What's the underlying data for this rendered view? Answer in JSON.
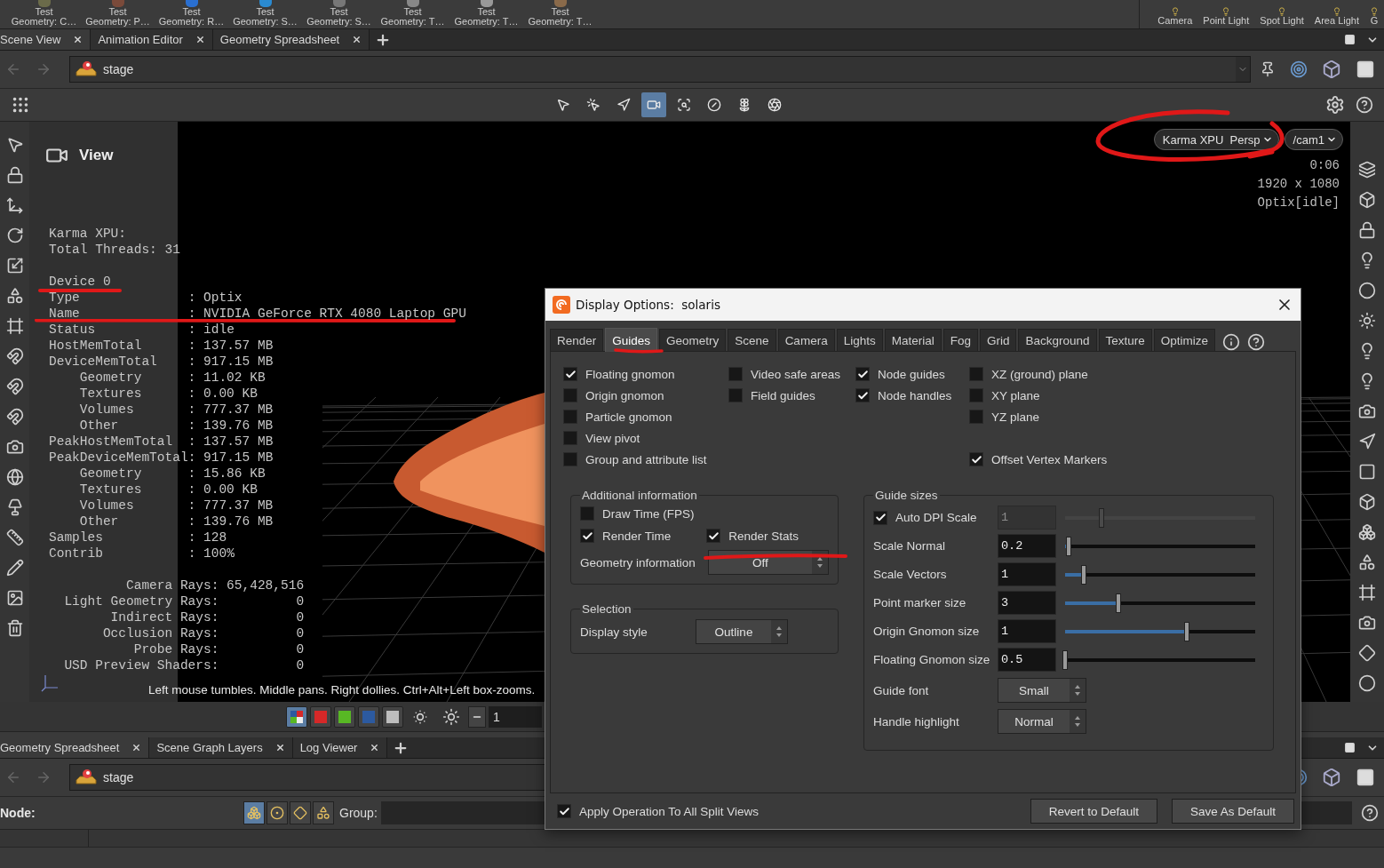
{
  "shelf": {
    "tools": [
      {
        "label": "Test",
        "sublabel": "Geometry: C…"
      },
      {
        "label": "Test",
        "sublabel": "Geometry: P…"
      },
      {
        "label": "Test",
        "sublabel": "Geometry: R…"
      },
      {
        "label": "Test",
        "sublabel": "Geometry: S…"
      },
      {
        "label": "Test",
        "sublabel": "Geometry: S…"
      },
      {
        "label": "Test",
        "sublabel": "Geometry: T…"
      },
      {
        "label": "Test",
        "sublabel": "Geometry: T…"
      },
      {
        "label": "Test",
        "sublabel": "Geometry: T…"
      }
    ],
    "lights": [
      "Camera",
      "Point Light",
      "Spot Light",
      "Area Light",
      "G"
    ]
  },
  "pane_tabs": [
    {
      "label": "Scene View",
      "selected": true
    },
    {
      "label": "Animation Editor",
      "selected": false
    },
    {
      "label": "Geometry Spreadsheet",
      "selected": false
    }
  ],
  "path": "stage",
  "viewport_tools": [
    {
      "kind": "select",
      "selected": false
    },
    {
      "kind": "pick",
      "selected": false
    },
    {
      "kind": "move",
      "selected": false
    },
    {
      "kind": "camera",
      "selected": true
    },
    {
      "kind": "view",
      "selected": false
    },
    {
      "kind": "stop",
      "selected": false
    },
    {
      "kind": "flower",
      "selected": false
    },
    {
      "kind": "aperture",
      "selected": false
    }
  ],
  "viewport": {
    "title": "View",
    "render_info": [
      "Karma XPU:",
      "Total Threads: 31"
    ],
    "device": "Device 0",
    "stats": [
      {
        "label": "Type",
        "value": ": Optix"
      },
      {
        "label": "Name",
        "value": ": NVIDIA GeForce RTX 4080 Laptop GPU"
      },
      {
        "label": "Status",
        "value": ": idle"
      },
      {
        "label": "HostMemTotal",
        "value": ": 137.57 MB"
      },
      {
        "label": "DeviceMemTotal",
        "value": ": 917.15 MB",
        "children": [
          {
            "label": "Geometry",
            "value": ": 11.02 KB"
          },
          {
            "label": "Textures",
            "value": ": 0.00 KB"
          },
          {
            "label": "Volumes",
            "value": ": 777.37 MB"
          },
          {
            "label": "Other",
            "value": ": 139.76 MB"
          }
        ]
      },
      {
        "label": "PeakHostMemTotal",
        "value": ": 137.57 MB"
      },
      {
        "label": "PeakDeviceMemTotal",
        "value": ": 917.15 MB",
        "children": [
          {
            "label": "Geometry",
            "value": ": 15.86 KB"
          },
          {
            "label": "Textures",
            "value": ": 0.00 KB"
          },
          {
            "label": "Volumes",
            "value": ": 777.37 MB"
          },
          {
            "label": "Other",
            "value": ": 139.76 MB"
          }
        ]
      },
      {
        "label": "Samples",
        "value": ": 128"
      },
      {
        "label": "Contrib",
        "value": ": 100%"
      }
    ],
    "rays": [
      {
        "label": "Camera Rays:",
        "value": "65,428,516"
      },
      {
        "label": "Light Geometry Rays:",
        "value": "0"
      },
      {
        "label": "Indirect Rays:",
        "value": "0"
      },
      {
        "label": "Occlusion Rays:",
        "value": "0"
      },
      {
        "label": "Probe Rays:",
        "value": "0"
      },
      {
        "label": "USD Preview Shaders:",
        "value": "0"
      }
    ],
    "renderer_menu": "Karma XPU  Persp",
    "camera_menu": "/cam1",
    "overlay": [
      "0:06",
      "1920 x 1080",
      "Optix[idle]"
    ],
    "hint": "Left mouse tumbles. Middle pans. Right dollies. Ctrl+Alt+Left box-zooms."
  },
  "viewport_bar": {
    "channels": [
      {
        "kind": "all",
        "selected": true
      },
      {
        "kind": "red",
        "selected": false
      },
      {
        "kind": "green",
        "selected": false
      },
      {
        "kind": "blue",
        "selected": false
      },
      {
        "kind": "alpha",
        "selected": false
      }
    ],
    "step_value": "1"
  },
  "lower_tabs": [
    {
      "label": "Geometry Spreadsheet",
      "selected": true
    },
    {
      "label": "Scene Graph Layers",
      "selected": false
    },
    {
      "label": "Log Viewer",
      "selected": false
    }
  ],
  "lower_path": "stage",
  "node_bar": {
    "node_label": "Node:",
    "filters": [
      {
        "kind": "cluster",
        "selected": true
      },
      {
        "kind": "dot",
        "selected": false
      },
      {
        "kind": "diamond",
        "selected": false
      },
      {
        "kind": "shapes",
        "selected": false
      }
    ],
    "group_label": "Group:"
  },
  "dialog": {
    "title": "Display Options:  solaris",
    "tabs": [
      {
        "label": "Render",
        "selected": false
      },
      {
        "label": "Guides",
        "selected": true
      },
      {
        "label": "Geometry",
        "selected": false
      },
      {
        "label": "Scene",
        "selected": false
      },
      {
        "label": "Camera",
        "selected": false
      },
      {
        "label": "Lights",
        "selected": false
      },
      {
        "label": "Material",
        "selected": false
      },
      {
        "label": "Fog",
        "selected": false
      },
      {
        "label": "Grid",
        "selected": false
      },
      {
        "label": "Background",
        "selected": false
      },
      {
        "label": "Texture",
        "selected": false
      },
      {
        "label": "Optimize",
        "selected": false
      }
    ],
    "checkbox_rows": [
      [
        {
          "label": "Floating gnomon",
          "checked": true
        },
        {
          "label": "Video safe areas",
          "checked": false
        },
        {
          "label": "Node guides",
          "checked": true
        },
        {
          "label": "XZ (ground) plane",
          "checked": false
        }
      ],
      [
        {
          "label": "Origin gnomon",
          "checked": false
        },
        {
          "label": "Field guides",
          "checked": false
        },
        {
          "label": "Node handles",
          "checked": true
        },
        {
          "label": "XY plane",
          "checked": false
        }
      ],
      [
        {
          "label": "Particle gnomon",
          "checked": false
        },
        null,
        null,
        {
          "label": "YZ plane",
          "checked": false
        }
      ],
      [
        {
          "label": "View pivot",
          "checked": false
        },
        null,
        null,
        null
      ],
      [
        {
          "label": "Group and attribute list",
          "checked": false
        },
        null,
        null,
        {
          "label": "Offset Vertex Markers",
          "checked": true
        }
      ]
    ],
    "additional": {
      "title": "Additional information",
      "draw_time": {
        "label": "Draw Time (FPS)",
        "checked": false
      },
      "render_time": {
        "label": "Render Time",
        "checked": true
      },
      "render_stats": {
        "label": "Render Stats",
        "checked": true
      },
      "geometry_label": "Geometry information",
      "geometry_value": "Off"
    },
    "selection": {
      "title": "Selection",
      "label": "Display style",
      "value": "Outline"
    },
    "guide_sizes": {
      "title": "Guide sizes",
      "auto_dpi": {
        "label": "Auto DPI Scale",
        "checked": true,
        "value": "1",
        "disabled": true,
        "level": 0.19
      },
      "sliders": [
        {
          "label": "Scale Normal",
          "value": "0.2",
          "level": 0.02
        },
        {
          "label": "Scale Vectors",
          "value": "1",
          "level": 0.1
        },
        {
          "label": "Point marker size",
          "value": "3",
          "level": 0.28
        },
        {
          "label": "Origin Gnomon size",
          "value": "1",
          "level": 0.64
        },
        {
          "label": "Floating Gnomon size",
          "value": "0.5",
          "level": 0.0
        }
      ],
      "menus": [
        {
          "label": "Guide font",
          "value": "Small"
        },
        {
          "label": "Handle highlight",
          "value": "Normal"
        }
      ]
    },
    "apply": {
      "label": "Apply Operation To All Split Views",
      "checked": true
    },
    "buttons": [
      "Revert to Default",
      "Save As Default"
    ]
  }
}
